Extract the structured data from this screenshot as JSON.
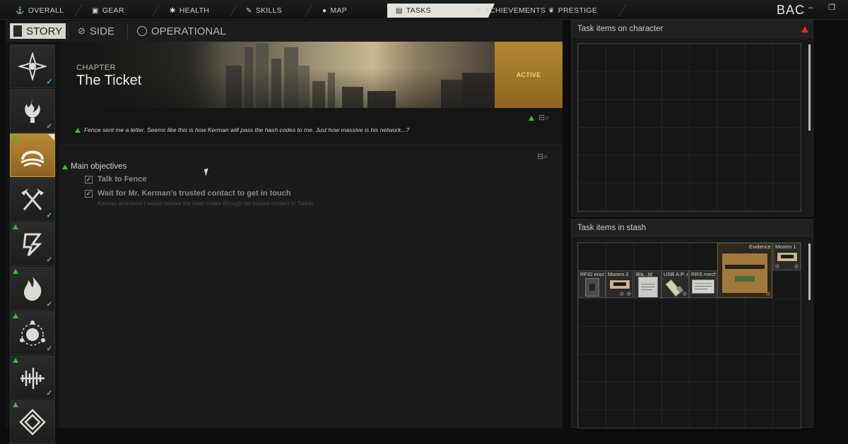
{
  "topnav": {
    "tabs": [
      {
        "label": "OVERALL",
        "icon": "anchor-icon"
      },
      {
        "label": "GEAR",
        "icon": "gear-icon"
      },
      {
        "label": "HEALTH",
        "icon": "health-icon"
      },
      {
        "label": "SKILLS",
        "icon": "skills-icon"
      },
      {
        "label": "MAP",
        "icon": "map-pin-icon"
      },
      {
        "label": "TASKS",
        "icon": "tasks-icon",
        "active": true
      },
      {
        "label": "ACHIEVEMENTS",
        "icon": "achievement-icon"
      },
      {
        "label": "PRESTIGE",
        "icon": "prestige-icon"
      }
    ],
    "back_label": "BAC"
  },
  "categories": {
    "story": "STORY",
    "side": "SIDE",
    "operational": "OPERATIONAL"
  },
  "chapters": [
    {
      "icon": "compass-star-icon",
      "warn": false,
      "done": true
    },
    {
      "icon": "flame-hand-icon",
      "warn": false,
      "done": true
    },
    {
      "icon": "tunnel-icon",
      "warn": true,
      "done": false,
      "selected": true
    },
    {
      "icon": "crossed-axes-icon",
      "warn": false,
      "done": true
    },
    {
      "icon": "lightning-icon",
      "warn": true,
      "done": true
    },
    {
      "icon": "fire-icon",
      "warn": true,
      "done": true
    },
    {
      "icon": "orbit-icon",
      "warn": true,
      "done": true
    },
    {
      "icon": "soundwave-icon",
      "warn": true,
      "done": true
    },
    {
      "icon": "maze-icon",
      "warn": true,
      "done": false
    }
  ],
  "quest": {
    "chapter_label": "CHAPTER",
    "title": "The Ticket",
    "status": "ACTIVE",
    "description": "Fence sent me a letter. Seems like this is how Kerman will pass the hash codes to me. Just how massive is his network...?",
    "objectives_title": "Main objectives",
    "objectives": [
      {
        "text": "Talk to Fence",
        "done": true
      },
      {
        "text": "Wait for Mr. Kerman's trusted contact to get in touch",
        "done": true
      }
    ],
    "objective_note": "Kerman promised I would receive the hash codes through his trusted contact in Tarkov"
  },
  "character_panel": {
    "title": "Task items on character"
  },
  "stash_panel": {
    "title": "Task items in stash",
    "items": [
      {
        "name": "Evidence",
        "icon": "evidence-case-icon"
      },
      {
        "name": "Morem 1",
        "icon": "cassette-icon"
      },
      {
        "name": "RFID encr",
        "icon": "rfid-device-icon"
      },
      {
        "name": "Morem 2",
        "icon": "cassette-icon"
      },
      {
        "name": "Bla...bl",
        "icon": "document-icon"
      },
      {
        "name": "USB A.P. d",
        "icon": "usb-drive-icon"
      },
      {
        "name": "RRS mech",
        "icon": "blueprint-icon"
      }
    ]
  },
  "colors": {
    "accent_orange": "#b3862f",
    "warn_green": "#34c234",
    "warn_red": "#e02a2a",
    "check_blue": "#5fb8d6"
  }
}
